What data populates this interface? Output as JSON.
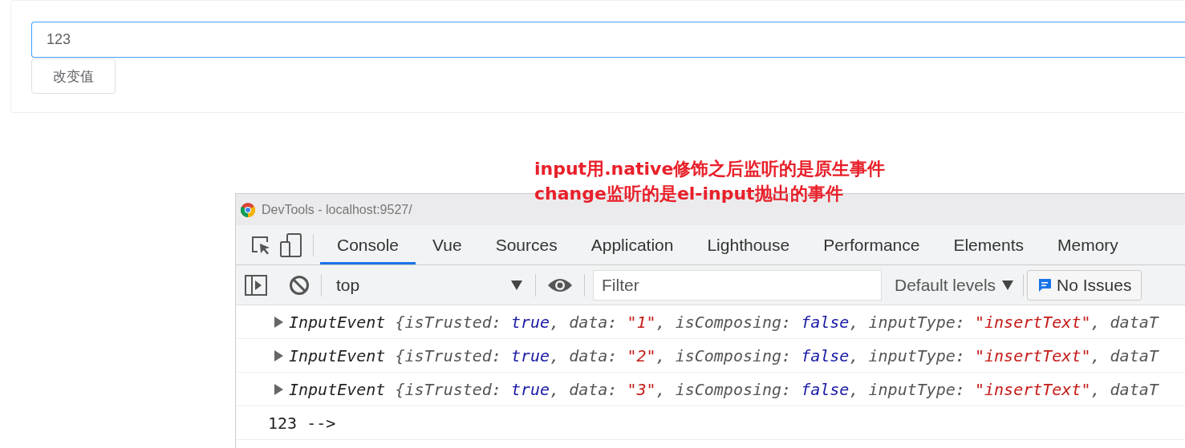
{
  "form": {
    "input": {
      "value": "123"
    },
    "button": {
      "label": "改变值"
    }
  },
  "annotation": {
    "lines": [
      "input用.native修饰之后监听的是原生事件",
      "change监听的是el-input抛出的事件"
    ]
  },
  "devtools": {
    "title": "DevTools - localhost:9527/",
    "tabs": [
      {
        "label": "Console",
        "selected": true
      },
      {
        "label": "Vue",
        "selected": false
      },
      {
        "label": "Sources",
        "selected": false
      },
      {
        "label": "Application",
        "selected": false
      },
      {
        "label": "Lighthouse",
        "selected": false
      },
      {
        "label": "Performance",
        "selected": false
      },
      {
        "label": "Elements",
        "selected": false
      },
      {
        "label": "Memory",
        "selected": false
      }
    ],
    "toolbar": {
      "context": "top",
      "filter": {
        "placeholder": "Filter"
      },
      "levels": "Default levels",
      "issues": "No Issues"
    },
    "console": [
      {
        "kind": "event",
        "expanded": false,
        "segments": [
          {
            "kind": "name",
            "text": "InputEvent "
          },
          {
            "kind": "key",
            "text": "{isTrusted: "
          },
          {
            "kind": "keyword",
            "text": "true"
          },
          {
            "kind": "key",
            "text": ", data: "
          },
          {
            "kind": "string",
            "text": "\"1\""
          },
          {
            "kind": "key",
            "text": ", isComposing: "
          },
          {
            "kind": "keyword",
            "text": "false"
          },
          {
            "kind": "key",
            "text": ", inputType: "
          },
          {
            "kind": "string",
            "text": "\"insertText\""
          },
          {
            "kind": "key",
            "text": ", dataT"
          }
        ]
      },
      {
        "kind": "event",
        "expanded": false,
        "segments": [
          {
            "kind": "name",
            "text": "InputEvent "
          },
          {
            "kind": "key",
            "text": "{isTrusted: "
          },
          {
            "kind": "keyword",
            "text": "true"
          },
          {
            "kind": "key",
            "text": ", data: "
          },
          {
            "kind": "string",
            "text": "\"2\""
          },
          {
            "kind": "key",
            "text": ", isComposing: "
          },
          {
            "kind": "keyword",
            "text": "false"
          },
          {
            "kind": "key",
            "text": ", inputType: "
          },
          {
            "kind": "string",
            "text": "\"insertText\""
          },
          {
            "kind": "key",
            "text": ", dataT"
          }
        ]
      },
      {
        "kind": "event",
        "expanded": false,
        "segments": [
          {
            "kind": "name",
            "text": "InputEvent "
          },
          {
            "kind": "key",
            "text": "{isTrusted: "
          },
          {
            "kind": "keyword",
            "text": "true"
          },
          {
            "kind": "key",
            "text": ", data: "
          },
          {
            "kind": "string",
            "text": "\"3\""
          },
          {
            "kind": "key",
            "text": ", isComposing: "
          },
          {
            "kind": "keyword",
            "text": "false"
          },
          {
            "kind": "key",
            "text": ", inputType: "
          },
          {
            "kind": "string",
            "text": "\"insertText\""
          },
          {
            "kind": "key",
            "text": ", dataT"
          }
        ]
      },
      {
        "kind": "log",
        "text": "123 -->"
      }
    ]
  }
}
